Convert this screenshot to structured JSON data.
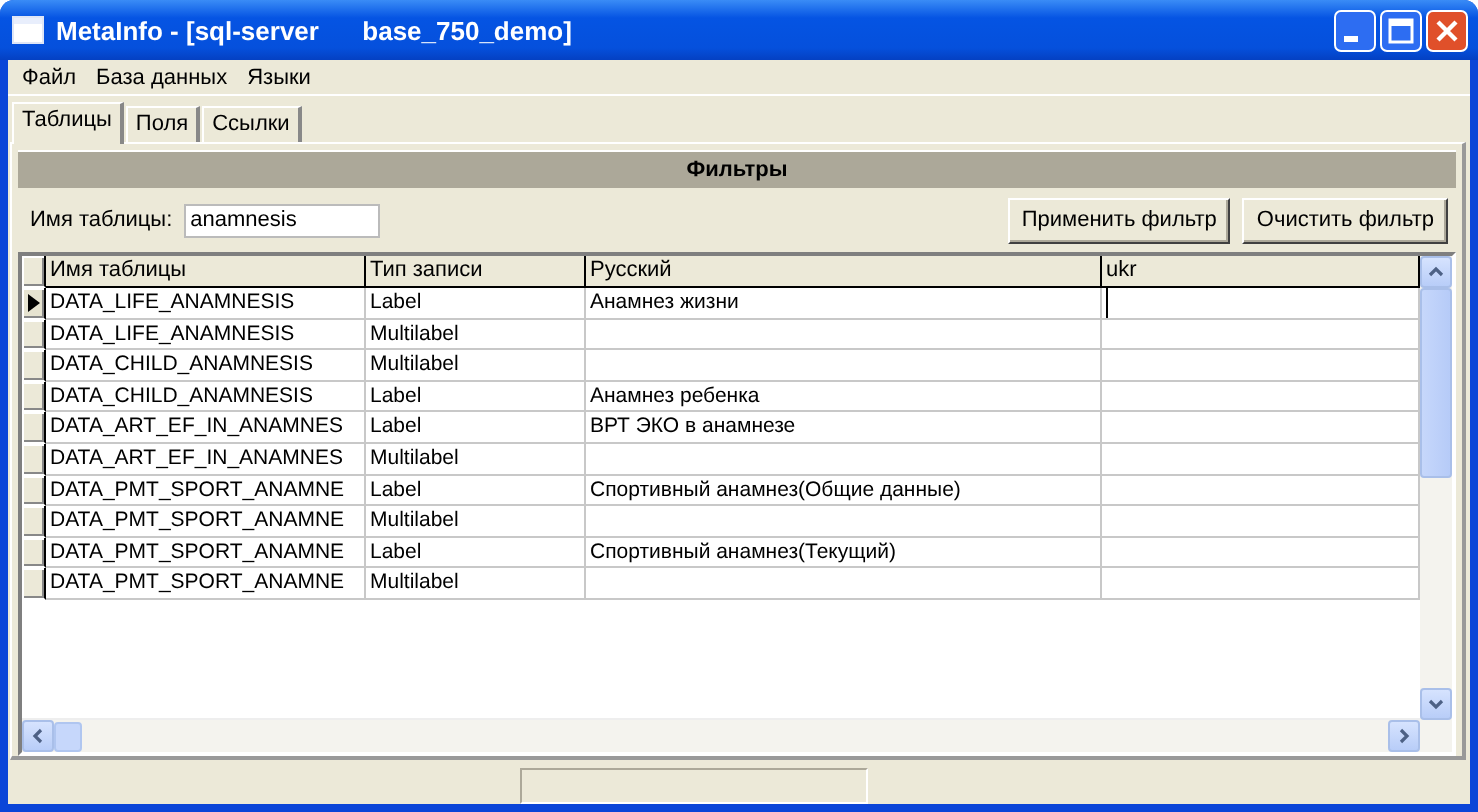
{
  "window": {
    "title": "MetaInfo - [sql-server      base_750_demo]"
  },
  "menu": [
    "Файл",
    "База данных",
    "Языки"
  ],
  "tabs": [
    {
      "label": "Таблицы",
      "selected": true
    },
    {
      "label": "Поля",
      "selected": false
    },
    {
      "label": "Ссылки",
      "selected": false
    }
  ],
  "filter": {
    "header": "Фильтры",
    "label": "Имя таблицы:",
    "value": "anamnesis",
    "buttons": [
      "Применить фильтр",
      "Очистить фильтр"
    ]
  },
  "table": {
    "columns": [
      "Имя таблицы",
      "Тип записи",
      "Русский",
      "ukr"
    ],
    "rows": [
      {
        "selected": true,
        "cells": [
          "DATA_LIFE_ANAMNESIS",
          "Label",
          "Анамнез жизни",
          ""
        ]
      },
      {
        "selected": false,
        "cells": [
          "DATA_LIFE_ANAMNESIS",
          "Multilabel",
          "",
          ""
        ]
      },
      {
        "selected": false,
        "cells": [
          "DATA_CHILD_ANAMNESIS",
          "Multilabel",
          "",
          ""
        ]
      },
      {
        "selected": false,
        "cells": [
          "DATA_CHILD_ANAMNESIS",
          "Label",
          "Анамнез ребенка",
          ""
        ]
      },
      {
        "selected": false,
        "cells": [
          "DATA_ART_EF_IN_ANAMNES",
          "Label",
          "ВРТ ЭКО в анамнезе",
          ""
        ]
      },
      {
        "selected": false,
        "cells": [
          "DATA_ART_EF_IN_ANAMNES",
          "Multilabel",
          "",
          ""
        ]
      },
      {
        "selected": false,
        "cells": [
          "DATA_PMT_SPORT_ANAMNE",
          "Label",
          "Спортивный анамнез(Общие данные)",
          ""
        ]
      },
      {
        "selected": false,
        "cells": [
          "DATA_PMT_SPORT_ANAMNE",
          "Multilabel",
          "",
          ""
        ]
      },
      {
        "selected": false,
        "cells": [
          "DATA_PMT_SPORT_ANAMNE",
          "Label",
          "Спортивный анамнез(Текущий)",
          ""
        ]
      },
      {
        "selected": false,
        "cells": [
          "DATA_PMT_SPORT_ANAMNE",
          "Multilabel",
          "",
          ""
        ]
      }
    ]
  }
}
